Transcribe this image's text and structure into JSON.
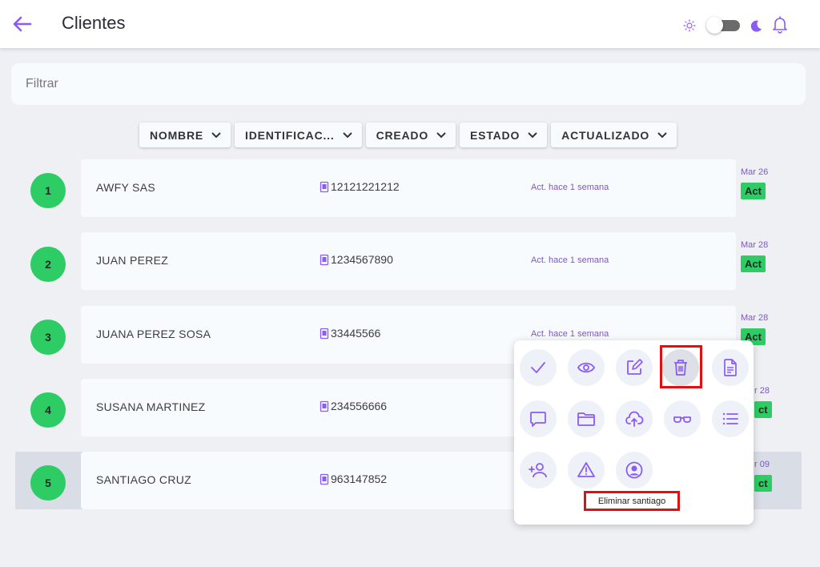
{
  "header": {
    "title": "Clientes",
    "back_icon": "arrow-left-icon",
    "theme_icons": [
      "sun-icon",
      "moon-icon"
    ],
    "notify_icon": "bell-icon",
    "accent": "#8a5cf6"
  },
  "filter": {
    "placeholder": "Filtrar",
    "value": ""
  },
  "sort": [
    {
      "label": "NOMBRE",
      "icon": "chevron-down-icon"
    },
    {
      "label": "IDENTIFICAC...",
      "icon": "chevron-down-icon"
    },
    {
      "label": "CREADO",
      "icon": "chevron-down-icon"
    },
    {
      "label": "ESTADO",
      "icon": "chevron-down-icon"
    },
    {
      "label": "ACTUALIZADO",
      "icon": "chevron-down-icon"
    }
  ],
  "rows": [
    {
      "num": "1",
      "name": "AWFY SAS",
      "id": "12121221212",
      "updated": "Act. hace 1 semana",
      "date": "Mar 26",
      "status": "Act"
    },
    {
      "num": "2",
      "name": "JUAN PEREZ",
      "id": "1234567890",
      "updated": "Act. hace 1 semana",
      "date": "Mar 28",
      "status": "Act"
    },
    {
      "num": "3",
      "name": "JUANA PEREZ SOSA",
      "id": "33445566",
      "updated": "Act. hace 1 semana",
      "date": "Mar 28",
      "status": "Act"
    },
    {
      "num": "4",
      "name": "SUSANA MARTINEZ",
      "id": "234556666",
      "updated": "",
      "date": "r 28",
      "status": "ct"
    },
    {
      "num": "5",
      "name": "SANTIAGO CRUZ",
      "id": "963147852",
      "updated": "",
      "date": "r 09",
      "status": "ct"
    }
  ],
  "actions_menu": {
    "icons": [
      "check-icon",
      "eye-icon",
      "edit-icon",
      "trash-icon",
      "document-icon",
      "chat-icon",
      "folder-icon",
      "cloud-upload-icon",
      "glasses-icon",
      "list-icon",
      "add-user-icon",
      "warning-icon",
      "user-circle-icon"
    ],
    "tooltip": "Eliminar santiago",
    "icon_color": "#8a5cf6",
    "highlight_color": "#e01010"
  },
  "status_color": "#2ecc64"
}
